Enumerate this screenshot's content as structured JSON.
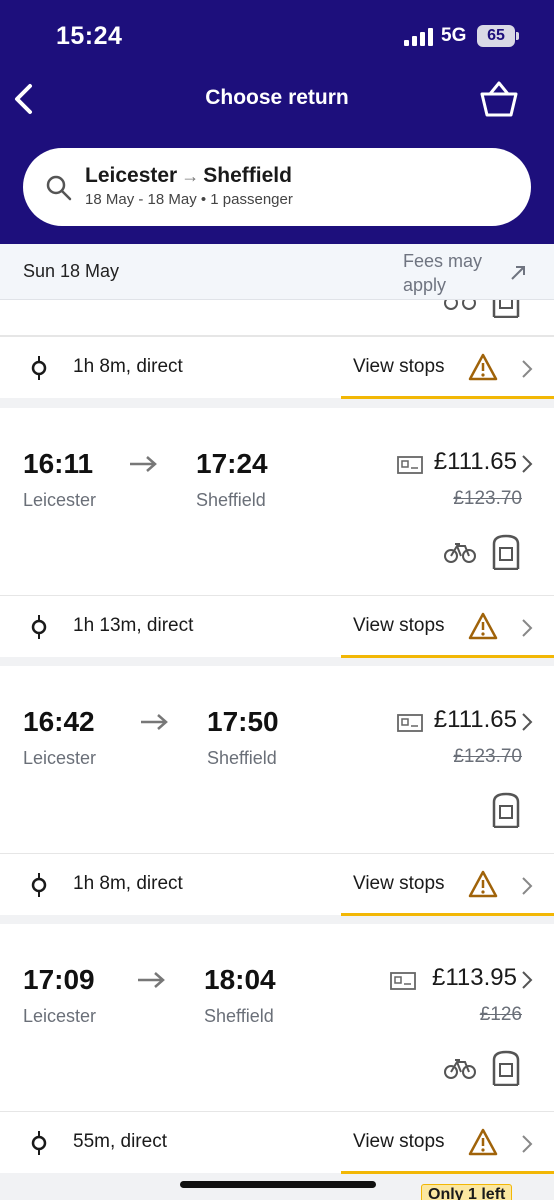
{
  "status_bar": {
    "time": "15:24",
    "network": "5G",
    "battery": "65"
  },
  "header": {
    "title": "Choose return"
  },
  "search": {
    "origin": "Leicester",
    "destination": "Sheffield",
    "details": "18 May - 18 May • 1 passenger"
  },
  "date_bar": {
    "date": "Sun 18 May",
    "fees_note": "Fees may apply"
  },
  "partial_journey": {
    "duration": "1h 8m, direct",
    "view_stops_label": "View stops"
  },
  "journeys": [
    {
      "depart_time": "16:11",
      "depart_station": "Leicester",
      "arrive_time": "17:24",
      "arrive_station": "Sheffield",
      "price": "£111.65",
      "old_price": "£123.70",
      "bike": true,
      "duration": "1h 13m, direct",
      "view_stops_label": "View stops"
    },
    {
      "depart_time": "16:42",
      "depart_station": "Leicester",
      "arrive_time": "17:50",
      "arrive_station": "Sheffield",
      "price": "£111.65",
      "old_price": "£123.70",
      "bike": false,
      "duration": "1h 8m, direct",
      "view_stops_label": "View stops"
    },
    {
      "depart_time": "17:09",
      "depart_station": "Leicester",
      "arrive_time": "18:04",
      "arrive_station": "Sheffield",
      "price": "£113.95",
      "old_price": "£126",
      "bike": true,
      "duration": "55m, direct",
      "view_stops_label": "View stops"
    }
  ],
  "availability_badge": "Only 1 left",
  "colors": {
    "header_bg": "#1d0f7c",
    "accent": "#f2b705",
    "warning": "#a0630a"
  },
  "icons": [
    "back-icon",
    "basket-icon",
    "search-icon",
    "external-link-icon",
    "ticket-icon",
    "bike-icon",
    "seat-icon",
    "stop-icon",
    "warning-icon",
    "chevron-right-icon"
  ]
}
